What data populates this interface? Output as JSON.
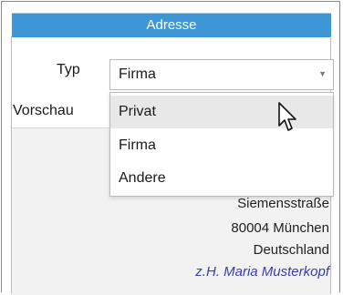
{
  "header": {
    "title": "Adresse"
  },
  "form": {
    "type_label": "Typ",
    "preview_label": "Vorschau",
    "type_select": {
      "selected": "Firma",
      "options": [
        "Privat",
        "Firma",
        "Andere"
      ],
      "hovered": "Privat"
    }
  },
  "preview": {
    "street": "Siemensstraße",
    "city": "80004 München",
    "country": "Deutschland",
    "attention": "z.H. Maria Musterkopf"
  },
  "icons": {
    "dropdown_arrow": "chevron-down-icon",
    "cursor": "mouse-pointer-icon"
  },
  "colors": {
    "header_bg": "#3d96d6",
    "attention_text": "#3b3bb0",
    "hover_bg": "#e8e8e8"
  }
}
